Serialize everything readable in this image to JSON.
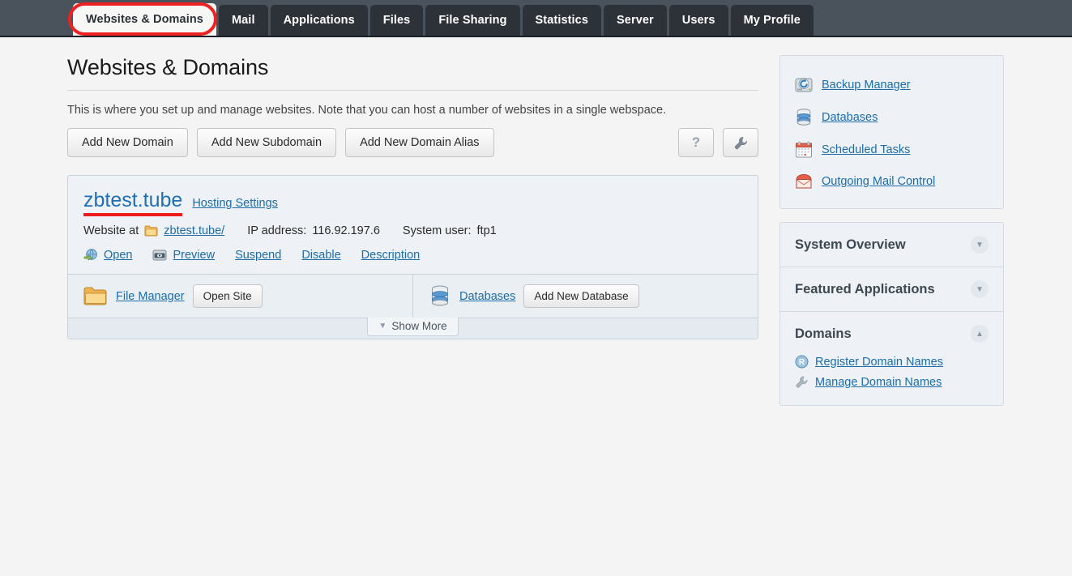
{
  "topbar": {
    "tabs": [
      {
        "label": "Websites & Domains",
        "active": true
      },
      {
        "label": "Mail",
        "active": false
      },
      {
        "label": "Applications",
        "active": false
      },
      {
        "label": "Files",
        "active": false
      },
      {
        "label": "File Sharing",
        "active": false
      },
      {
        "label": "Statistics",
        "active": false
      },
      {
        "label": "Server",
        "active": false
      },
      {
        "label": "Users",
        "active": false
      },
      {
        "label": "My Profile",
        "active": false
      }
    ],
    "annotation_color": "#ee2222"
  },
  "main": {
    "title": "Websites & Domains",
    "intro": "This is where you set up and manage websites. Note that you can host a number of websites in a single webspace.",
    "buttons": {
      "add_domain": "Add New Domain",
      "add_subdomain": "Add New Subdomain",
      "add_alias": "Add New Domain Alias",
      "help_icon": "?",
      "wrench_icon": "wrench"
    }
  },
  "domain_card": {
    "name": "zbtest.tube",
    "name_underline_color": "#ee1c1c",
    "hosting_settings": "Hosting Settings",
    "website_at_label": "Website at",
    "website_path": "zbtest.tube/",
    "ip_label": "IP address:",
    "ip_value": "116.92.197.6",
    "system_user_label": "System user:",
    "system_user_value": "ftp1",
    "actions": [
      {
        "label": "Open",
        "icon": "globe-arrow-icon"
      },
      {
        "label": "Preview",
        "icon": "screen-icon"
      },
      {
        "label": "Suspend",
        "icon": "none"
      },
      {
        "label": "Disable",
        "icon": "none"
      },
      {
        "label": "Description",
        "icon": "none"
      }
    ],
    "tools": [
      {
        "link": "File Manager",
        "icon": "folder-icon",
        "button": "Open Site"
      },
      {
        "link": "Databases",
        "icon": "database-icon",
        "button": "Add New Database"
      }
    ],
    "show_more": "Show More"
  },
  "sidebar": {
    "shortcuts": [
      {
        "label": "Backup Manager",
        "icon": "backup-disk-icon"
      },
      {
        "label": "Databases",
        "icon": "database-icon"
      },
      {
        "label": "Scheduled Tasks",
        "icon": "calendar-icon"
      },
      {
        "label": "Outgoing Mail Control",
        "icon": "mail-icon"
      }
    ],
    "sections": [
      {
        "title": "System Overview",
        "expanded": false,
        "items": []
      },
      {
        "title": "Featured Applications",
        "expanded": false,
        "items": []
      },
      {
        "title": "Domains",
        "expanded": true,
        "items": [
          {
            "label": "Register Domain Names",
            "icon": "registered-r-icon"
          },
          {
            "label": "Manage Domain Names",
            "icon": "wrench-icon"
          }
        ]
      }
    ]
  }
}
